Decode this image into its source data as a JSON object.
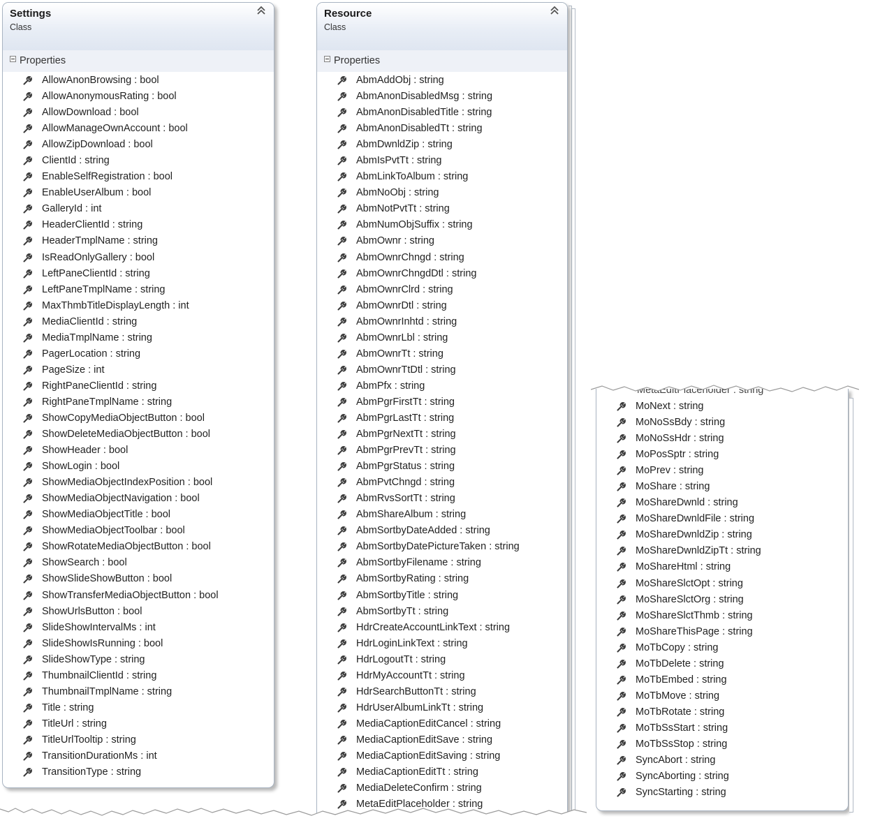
{
  "settings_box": {
    "name": "Settings",
    "kind": "Class",
    "collapse_glyph": "⌃",
    "section_label": "Properties",
    "properties": [
      "AllowAnonBrowsing : bool",
      "AllowAnonymousRating : bool",
      "AllowDownload : bool",
      "AllowManageOwnAccount : bool",
      "AllowZipDownload : bool",
      "ClientId : string",
      "EnableSelfRegistration : bool",
      "EnableUserAlbum : bool",
      "GalleryId : int",
      "HeaderClientId : string",
      "HeaderTmplName : string",
      "IsReadOnlyGallery : bool",
      "LeftPaneClientId : string",
      "LeftPaneTmplName : string",
      "MaxThmbTitleDisplayLength : int",
      "MediaClientId : string",
      "MediaTmplName : string",
      "PagerLocation : string",
      "PageSize : int",
      "RightPaneClientId : string",
      "RightPaneTmplName : string",
      "ShowCopyMediaObjectButton : bool",
      "ShowDeleteMediaObjectButton : bool",
      "ShowHeader : bool",
      "ShowLogin : bool",
      "ShowMediaObjectIndexPosition : bool",
      "ShowMediaObjectNavigation : bool",
      "ShowMediaObjectTitle : bool",
      "ShowMediaObjectToolbar : bool",
      "ShowRotateMediaObjectButton : bool",
      "ShowSearch : bool",
      "ShowSlideShowButton : bool",
      "ShowTransferMediaObjectButton : bool",
      "ShowUrlsButton : bool",
      "SlideShowIntervalMs : int",
      "SlideShowIsRunning : bool",
      "SlideShowType : string",
      "ThumbnailClientId : string",
      "ThumbnailTmplName : string",
      "Title : string",
      "TitleUrl : string",
      "TitleUrlTooltip : string",
      "TransitionDurationMs : int",
      "TransitionType : string"
    ]
  },
  "resource_box": {
    "name": "Resource",
    "kind": "Class",
    "collapse_glyph": "⌃",
    "section_label": "Properties",
    "properties": [
      "AbmAddObj : string",
      "AbmAnonDisabledMsg : string",
      "AbmAnonDisabledTitle : string",
      "AbmAnonDisabledTt : string",
      "AbmDwnldZip : string",
      "AbmIsPvtTt : string",
      "AbmLinkToAlbum : string",
      "AbmNoObj : string",
      "AbmNotPvtTt : string",
      "AbmNumObjSuffix : string",
      "AbmOwnr : string",
      "AbmOwnrChngd : string",
      "AbmOwnrChngdDtl : string",
      "AbmOwnrClrd : string",
      "AbmOwnrDtl : string",
      "AbmOwnrInhtd : string",
      "AbmOwnrLbl : string",
      "AbmOwnrTt : string",
      "AbmOwnrTtDtl : string",
      "AbmPfx : string",
      "AbmPgrFirstTt : string",
      "AbmPgrLastTt : string",
      "AbmPgrNextTt : string",
      "AbmPgrPrevTt : string",
      "AbmPgrStatus : string",
      "AbmPvtChngd : string",
      "AbmRvsSortTt : string",
      "AbmShareAlbum : string",
      "AbmSortbyDateAdded : string",
      "AbmSortbyDatePictureTaken : string",
      "AbmSortbyFilename : string",
      "AbmSortbyRating : string",
      "AbmSortbyTitle : string",
      "AbmSortbyTt : string",
      "HdrCreateAccountLinkText : string",
      "HdrLoginLinkText : string",
      "HdrLogoutTt : string",
      "HdrMyAccountTt : string",
      "HdrSearchButtonTt : string",
      "HdrUserAlbumLinkTt : string",
      "MediaCaptionEditCancel : string",
      "MediaCaptionEditSave : string",
      "MediaCaptionEditSaving : string",
      "MediaCaptionEditTt : string",
      "MediaDeleteConfirm : string",
      "MetaEditPlaceholder : string"
    ]
  },
  "resource_continued": {
    "partial_top_label": "MetaEditPlaceholder : string",
    "properties": [
      "MoNext : string",
      "MoNoSsBdy : string",
      "MoNoSsHdr : string",
      "MoPosSptr : string",
      "MoPrev : string",
      "MoShare : string",
      "MoShareDwnld : string",
      "MoShareDwnldFile : string",
      "MoShareDwnldZip : string",
      "MoShareDwnldZipTt : string",
      "MoShareHtml : string",
      "MoShareSlctOpt : string",
      "MoShareSlctOrg : string",
      "MoShareSlctThmb : string",
      "MoShareThisPage : string",
      "MoTbCopy : string",
      "MoTbDelete : string",
      "MoTbEmbed : string",
      "MoTbMove : string",
      "MoTbRotate : string",
      "MoTbSsStart : string",
      "MoTbSsStop : string",
      "SyncAbort : string",
      "SyncAborting : string",
      "SyncStarting : string"
    ]
  },
  "icon_name": "wrench-icon",
  "colors": {
    "header_gradient_end": "#dfe6f1",
    "section_bg": "#eef1f7",
    "border": "#a9b4c2",
    "text": "#222222"
  }
}
